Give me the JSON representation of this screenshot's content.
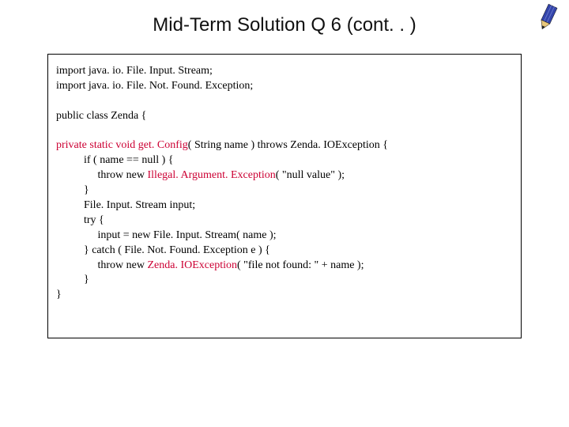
{
  "title": "Mid-Term Solution Q 6 (cont. . )",
  "code": {
    "l1": "import java. io. File. Input. Stream;",
    "l2": "import java. io. File. Not. Found. Exception;",
    "l3": "",
    "l4": "public class Zenda {",
    "l5": "",
    "l6a": "private static void get. Config",
    "l6b": "( String name ) throws Zenda. IOException {",
    "l7": "          if ( name == null ) {",
    "l8a": "               throw new ",
    "l8b": "Illegal. Argument. Exception",
    "l8c": "( \"null value\" );",
    "l9": "          }",
    "l10": "          File. Input. Stream input;",
    "l11": "          try {",
    "l12": "               input = new File. Input. Stream( name );",
    "l13": "          } catch ( File. Not. Found. Exception e ) {",
    "l14a": "               throw new ",
    "l14b": "Zenda. IOException",
    "l14c": "( \"file not found: \" + name );",
    "l15": "          }",
    "l16": "}"
  }
}
